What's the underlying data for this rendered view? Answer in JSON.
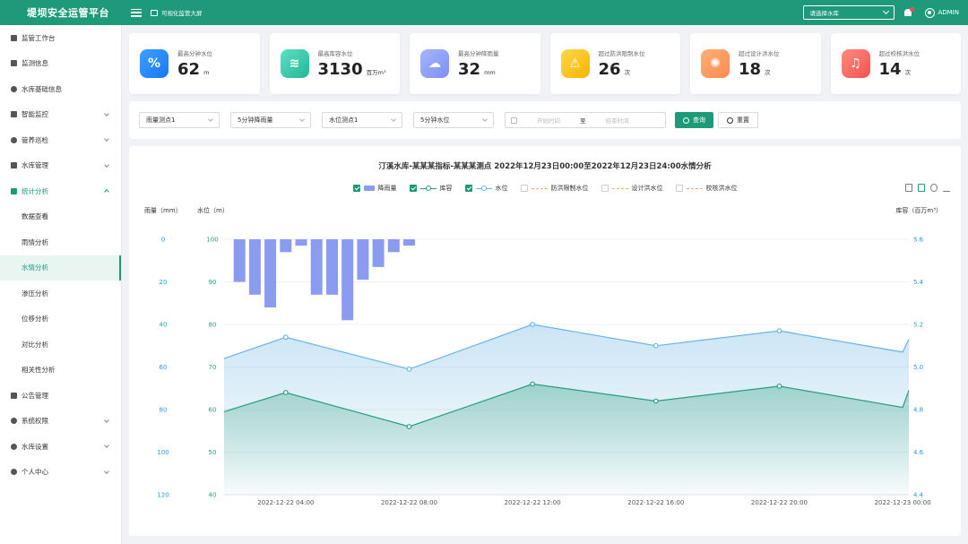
{
  "app": {
    "title": "堤坝安全运管平台",
    "screen_link": "可视化监管大屏"
  },
  "header": {
    "reservoir_select": "请选择水库",
    "user": "ADMIN"
  },
  "sidebar": {
    "items": [
      {
        "label": "监管工作台",
        "icon": "dashboard-icon"
      },
      {
        "label": "监测信息",
        "icon": "monitor-icon"
      },
      {
        "label": "水库基础信息",
        "icon": "reservoir-info-icon"
      },
      {
        "label": "智能监控",
        "icon": "camera-icon",
        "expandable": true
      },
      {
        "label": "管养巡检",
        "icon": "inspection-icon",
        "expandable": true
      },
      {
        "label": "水库管理",
        "icon": "layers-icon",
        "expandable": true
      },
      {
        "label": "统计分析",
        "icon": "stats-icon",
        "expandable": true,
        "open": true
      }
    ],
    "sub_items": [
      "数据查看",
      "雨情分析",
      "水情分析",
      "渗压分析",
      "位移分析",
      "对比分析",
      "相关性分析"
    ],
    "active_sub": "水情分析",
    "bottom_items": [
      {
        "label": "公告管理",
        "icon": "notice-icon"
      },
      {
        "label": "系统权限",
        "icon": "shield-icon",
        "expandable": true
      },
      {
        "label": "水库设置",
        "icon": "gear-icon",
        "expandable": true
      },
      {
        "label": "个人中心",
        "icon": "user-icon",
        "expandable": true
      }
    ]
  },
  "stats": [
    {
      "label": "最高分钟水位",
      "value": "62",
      "unit": "m",
      "color_from": "#3fa0ff",
      "color_to": "#1677ff",
      "icon": "water-level-icon",
      "glyph": "%"
    },
    {
      "label": "最高库容水位",
      "value": "3130",
      "unit": "百万m³",
      "color_from": "#5ee0c4",
      "color_to": "#21b894",
      "icon": "capacity-icon",
      "glyph": "≋"
    },
    {
      "label": "最高分钟降雨量",
      "value": "32",
      "unit": "mm",
      "color_from": "#a7b6ff",
      "color_to": "#7b8ff2",
      "icon": "rain-cloud-icon",
      "glyph": "☁"
    },
    {
      "label": "超过防洪限制水位",
      "value": "26",
      "unit": "次",
      "color_from": "#ffd84a",
      "color_to": "#f5b400",
      "icon": "warning-icon",
      "glyph": "⚠"
    },
    {
      "label": "超过设计洪水位",
      "value": "18",
      "unit": "次",
      "color_from": "#ffb07a",
      "color_to": "#ff8a4c",
      "icon": "alarm-light-icon",
      "glyph": "✺"
    },
    {
      "label": "超过校核洪水位",
      "value": "14",
      "unit": "次",
      "color_from": "#ff8a80",
      "color_to": "#f2534d",
      "icon": "bell-alert-icon",
      "glyph": "♫"
    }
  ],
  "filters": {
    "rain_point": "雨量测点1",
    "rain_interval": "5分钟降雨量",
    "level_point": "水位测点1",
    "level_interval": "5分钟水位",
    "start_placeholder": "开始时间",
    "range_sep": "至",
    "end_placeholder": "结束时间",
    "query": "查询",
    "reset": "重置"
  },
  "chart_data": {
    "type": "line",
    "title": "汀溪水库-某某某指标-某某某测点 2022年12月23日00:00至2022年12月23日24:00水情分析",
    "legend": [
      {
        "name": "降雨量",
        "checked": true,
        "style": "bar",
        "color": "#8a9bf0"
      },
      {
        "name": "库容",
        "checked": true,
        "style": "line",
        "color": "#2a9d7c"
      },
      {
        "name": "水位",
        "checked": true,
        "style": "line",
        "color": "#6ab4e4"
      },
      {
        "name": "防洪限制水位",
        "checked": false,
        "style": "dash",
        "color": "#f5a96b"
      },
      {
        "name": "设计洪水位",
        "checked": false,
        "style": "dash",
        "color": "#f5a96b"
      },
      {
        "name": "校核洪水位",
        "checked": false,
        "style": "dash",
        "color": "#f5a96b"
      }
    ],
    "axes": {
      "rain": {
        "label": "雨量（mm）",
        "min": 0,
        "max": 120,
        "ticks": [
          0,
          20,
          40,
          60,
          80,
          100,
          120
        ],
        "inverted": true
      },
      "level": {
        "label": "水位（m）",
        "min": 40,
        "max": 100,
        "ticks": [
          100,
          90,
          80,
          70,
          60,
          50,
          40
        ]
      },
      "capacity": {
        "label": "库容（百万m³）",
        "min": 4.4,
        "max": 5.6,
        "ticks": [
          "5.6",
          "5.4",
          "5.2",
          "5.0",
          "4.8",
          "4.6",
          "4.4"
        ]
      }
    },
    "x_labels": [
      "2022-12-22 04:00",
      "2022-12-22 08:00",
      "2022-12-22 12:00",
      "2022-12-22 16:00",
      "2022-12-22 20:00",
      "2022-12-23 00:00"
    ],
    "x_range": [
      2,
      24.2
    ],
    "rain_series": {
      "name": "降雨量",
      "x": [
        2.5,
        3,
        3.5,
        4,
        4.5,
        5,
        5.5,
        6,
        6.5,
        7,
        7.5,
        8,
        8.5
      ],
      "values": [
        20,
        26,
        32,
        6,
        3,
        26,
        26,
        38,
        19,
        13,
        6,
        3,
        0
      ]
    },
    "level_series": {
      "name": "水位",
      "x": [
        2,
        4,
        8,
        12,
        16,
        20,
        24,
        24.2
      ],
      "values": [
        72,
        77,
        69.5,
        80,
        75,
        78.5,
        73.5,
        76.5
      ]
    },
    "capacity_series": {
      "name": "库容",
      "x": [
        2,
        4,
        8,
        12,
        16,
        20,
        24,
        24.2
      ],
      "values": [
        4.79,
        4.88,
        4.72,
        4.92,
        4.84,
        4.91,
        4.81,
        4.89
      ]
    }
  }
}
